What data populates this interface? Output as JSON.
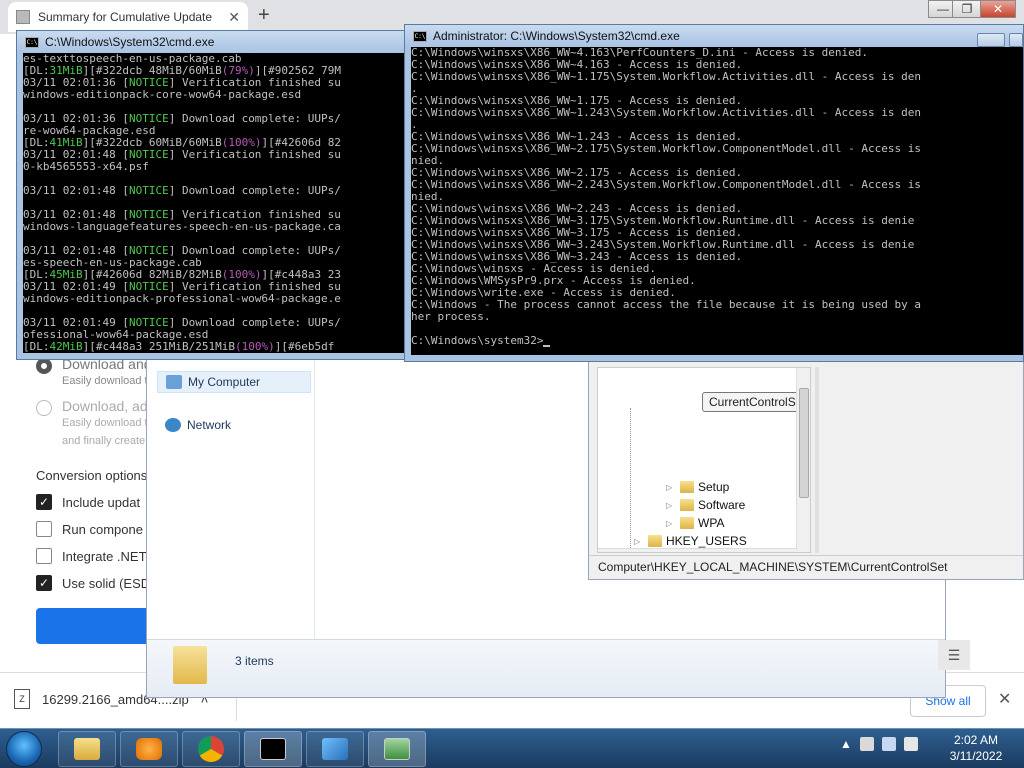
{
  "browser": {
    "tab_title": "Summary for Cumulative Update",
    "new_tab": "+",
    "tab_close": "✕",
    "options": [
      {
        "title": "Download and",
        "desc": "Easily download t"
      },
      {
        "title": "Download, ad",
        "desc": "Easily download t",
        "desc2": "and finally create"
      }
    ],
    "section_title": "Conversion options",
    "checks": [
      {
        "label": "Include updat",
        "checked": true
      },
      {
        "label": "Run compone",
        "checked": false
      },
      {
        "label": "Integrate .NET",
        "checked": false
      },
      {
        "label": "Use solid (ESD",
        "checked": true
      }
    ],
    "window_controls": {
      "minimize": "—",
      "maximize": "❐",
      "close": "✕"
    }
  },
  "downloads": {
    "file_name": "16299.2166_amd64....zip",
    "chevron": "˄",
    "show_all": "Show all",
    "close": "✕"
  },
  "explorer": {
    "nav": [
      {
        "label": "My Computer",
        "selected": true
      },
      {
        "label": "Network",
        "selected": false
      }
    ],
    "items_count": "3 items",
    "view_icon": "☰"
  },
  "regedit": {
    "tooltip": "CurrentControlSet",
    "nodes": [
      "Setup",
      "Software",
      "WPA",
      "HKEY_USERS"
    ],
    "status_path": "Computer\\HKEY_LOCAL_MACHINE\\SYSTEM\\CurrentControlSet"
  },
  "cmd1": {
    "title": "C:\\Windows\\System32\\cmd.exe",
    "lines": [
      [
        {
          "t": "es-texttospeech-en-us-package.cab",
          "c": "t-grey"
        }
      ],
      [
        {
          "t": "[DL:",
          "c": "t-grey"
        },
        {
          "t": "31MiB",
          "c": "t-green"
        },
        {
          "t": "][",
          "c": "t-grey"
        },
        {
          "t": "#322dcb 48MiB/60MiB",
          "c": "t-grey"
        },
        {
          "t": "(79%)",
          "c": "t-purple"
        },
        {
          "t": "][",
          "c": "t-grey"
        },
        {
          "t": "#902562 79M",
          "c": "t-grey"
        }
      ],
      [
        {
          "t": "03/11 02:01:36 [",
          "c": "t-grey"
        },
        {
          "t": "NOTICE",
          "c": "t-green"
        },
        {
          "t": "] Verification finished su",
          "c": "t-grey"
        }
      ],
      [
        {
          "t": "windows-editionpack-core-wow64-package.esd",
          "c": "t-grey"
        }
      ],
      [
        {
          "t": "",
          "c": "t-grey"
        }
      ],
      [
        {
          "t": "03/11 02:01:36 [",
          "c": "t-grey"
        },
        {
          "t": "NOTICE",
          "c": "t-green"
        },
        {
          "t": "] Download complete: UUPs/",
          "c": "t-grey"
        }
      ],
      [
        {
          "t": "re-wow64-package.esd",
          "c": "t-grey"
        }
      ],
      [
        {
          "t": "[DL:",
          "c": "t-grey"
        },
        {
          "t": "41MiB",
          "c": "t-green"
        },
        {
          "t": "][",
          "c": "t-grey"
        },
        {
          "t": "#322dcb 60MiB/60MiB",
          "c": "t-grey"
        },
        {
          "t": "(100%)",
          "c": "t-purple"
        },
        {
          "t": "][",
          "c": "t-grey"
        },
        {
          "t": "#42606d 82",
          "c": "t-grey"
        }
      ],
      [
        {
          "t": "03/11 02:01:48 [",
          "c": "t-grey"
        },
        {
          "t": "NOTICE",
          "c": "t-green"
        },
        {
          "t": "] Verification finished su",
          "c": "t-grey"
        }
      ],
      [
        {
          "t": "0-kb4565553-x64.psf",
          "c": "t-grey"
        }
      ],
      [
        {
          "t": "",
          "c": "t-grey"
        }
      ],
      [
        {
          "t": "03/11 02:01:48 [",
          "c": "t-grey"
        },
        {
          "t": "NOTICE",
          "c": "t-green"
        },
        {
          "t": "] Download complete: UUPs/",
          "c": "t-grey"
        }
      ],
      [
        {
          "t": "",
          "c": "t-grey"
        }
      ],
      [
        {
          "t": "03/11 02:01:48 [",
          "c": "t-grey"
        },
        {
          "t": "NOTICE",
          "c": "t-green"
        },
        {
          "t": "] Verification finished su",
          "c": "t-grey"
        }
      ],
      [
        {
          "t": "windows-languagefeatures-speech-en-us-package.ca",
          "c": "t-grey"
        }
      ],
      [
        {
          "t": "",
          "c": "t-grey"
        }
      ],
      [
        {
          "t": "03/11 02:01:48 [",
          "c": "t-grey"
        },
        {
          "t": "NOTICE",
          "c": "t-green"
        },
        {
          "t": "] Download complete: UUPs/",
          "c": "t-grey"
        }
      ],
      [
        {
          "t": "es-speech-en-us-package.cab",
          "c": "t-grey"
        }
      ],
      [
        {
          "t": "[DL:",
          "c": "t-grey"
        },
        {
          "t": "45MiB",
          "c": "t-green"
        },
        {
          "t": "][",
          "c": "t-grey"
        },
        {
          "t": "#42606d 82MiB/82MiB",
          "c": "t-grey"
        },
        {
          "t": "(100%)",
          "c": "t-purple"
        },
        {
          "t": "][",
          "c": "t-grey"
        },
        {
          "t": "#c448a3 23",
          "c": "t-grey"
        }
      ],
      [
        {
          "t": "03/11 02:01:49 [",
          "c": "t-grey"
        },
        {
          "t": "NOTICE",
          "c": "t-green"
        },
        {
          "t": "] Verification finished su",
          "c": "t-grey"
        }
      ],
      [
        {
          "t": "windows-editionpack-professional-wow64-package.e",
          "c": "t-grey"
        }
      ],
      [
        {
          "t": "",
          "c": "t-grey"
        }
      ],
      [
        {
          "t": "03/11 02:01:49 [",
          "c": "t-grey"
        },
        {
          "t": "NOTICE",
          "c": "t-green"
        },
        {
          "t": "] Download complete: UUPs/",
          "c": "t-grey"
        }
      ],
      [
        {
          "t": "ofessional-wow64-package.esd",
          "c": "t-grey"
        }
      ],
      [
        {
          "t": "[DL:",
          "c": "t-grey"
        },
        {
          "t": "42MiB",
          "c": "t-green"
        },
        {
          "t": "][",
          "c": "t-grey"
        },
        {
          "t": "#c448a3 251MiB/251MiB",
          "c": "t-grey"
        },
        {
          "t": "(100%)",
          "c": "t-purple"
        },
        {
          "t": "][",
          "c": "t-grey"
        },
        {
          "t": "#6eb5df",
          "c": "t-grey"
        }
      ]
    ]
  },
  "cmd2": {
    "title": "Administrator: C:\\Windows\\System32\\cmd.exe",
    "lines": [
      "C:\\Windows\\winsxs\\X86_WW~4.163\\PerfCounters_D.ini - Access is denied.",
      "C:\\Windows\\winsxs\\X86_WW~4.163 - Access is denied.",
      "C:\\Windows\\winsxs\\X86_WW~1.175\\System.Workflow.Activities.dll - Access is den",
      ".",
      "C:\\Windows\\winsxs\\X86_WW~1.175 - Access is denied.",
      "C:\\Windows\\winsxs\\X86_WW~1.243\\System.Workflow.Activities.dll - Access is den",
      ".",
      "C:\\Windows\\winsxs\\X86_WW~1.243 - Access is denied.",
      "C:\\Windows\\winsxs\\X86_WW~2.175\\System.Workflow.ComponentModel.dll - Access is",
      "nied.",
      "C:\\Windows\\winsxs\\X86_WW~2.175 - Access is denied.",
      "C:\\Windows\\winsxs\\X86_WW~2.243\\System.Workflow.ComponentModel.dll - Access is",
      "nied.",
      "C:\\Windows\\winsxs\\X86_WW~2.243 - Access is denied.",
      "C:\\Windows\\winsxs\\X86_WW~3.175\\System.Workflow.Runtime.dll - Access is denie",
      "C:\\Windows\\winsxs\\X86_WW~3.175 - Access is denied.",
      "C:\\Windows\\winsxs\\X86_WW~3.243\\System.Workflow.Runtime.dll - Access is denie",
      "C:\\Windows\\winsxs\\X86_WW~3.243 - Access is denied.",
      "C:\\Windows\\winsxs - Access is denied.",
      "C:\\Windows\\WMSysPr9.prx - Access is denied.",
      "C:\\Windows\\write.exe - Access is denied.",
      "C:\\Windows - The process cannot access the file because it is being used by a",
      "her process.",
      "",
      "C:\\Windows\\system32>"
    ]
  },
  "taskbar": {
    "clock_time": "2:02 AM",
    "clock_date": "3/11/2022",
    "tray_arrow": "▲"
  },
  "colors": {
    "accent": "#1a73e8",
    "console_bg": "#000000",
    "console_text": "#c0c0c0",
    "console_green": "#4ec94e",
    "console_purple": "#b45cb4"
  }
}
